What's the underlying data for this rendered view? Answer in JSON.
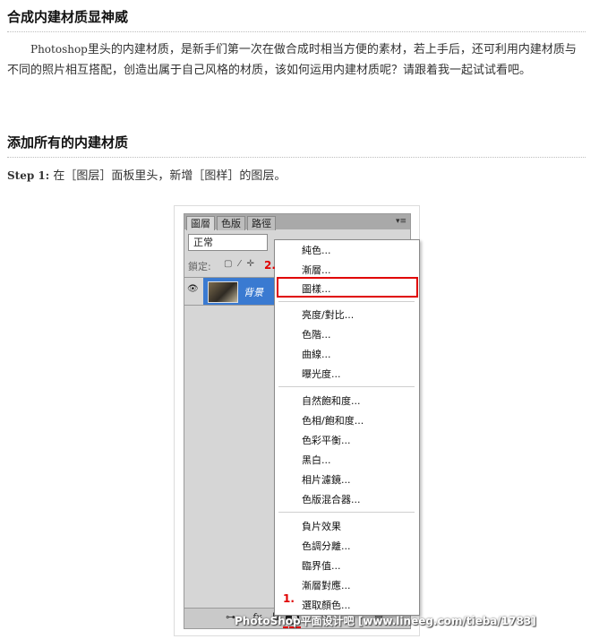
{
  "section1": {
    "title": "合成内建材质显神威",
    "intro_latin": "Photoshop",
    "intro_rest": "里头的内建材质，是新手们第一次在做合成时相当方便的素材，若上手后，还可利用内建材质与不同的照片相互搭配，创造出属于自己风格的材质，该如何运用内建材质呢？请跟着我一起试试看吧。"
  },
  "section2": {
    "title": "添加所有的内建材质",
    "step_label": "Step 1:",
    "step_text": "在［图层］面板里头，新增［图样］的图层。"
  },
  "screenshot": {
    "tabs": [
      "圖層",
      "色版",
      "路徑"
    ],
    "menu_glyph": "▾≡",
    "blend_mode": "正常",
    "lock_label": "鎖定:",
    "layer_name": "背景",
    "bottom_icons": [
      "link-icon",
      "fx-icon",
      "mask-icon",
      "adjustment-icon",
      "folder-icon",
      "new-layer-icon",
      "trash-icon"
    ],
    "bottom_fx": "fx",
    "marker_1": "1.",
    "marker_2": "2.",
    "menu_items": [
      "純色...",
      "漸層...",
      "圖樣...",
      "亮度/對比...",
      "色階...",
      "曲線...",
      "曝光度...",
      "自然飽和度...",
      "色相/飽和度...",
      "色彩平衡...",
      "黑白...",
      "相片濾鏡...",
      "色版混合器...",
      "負片效果",
      "色調分離...",
      "臨界值...",
      "漸層對應...",
      "選取顏色..."
    ],
    "highlighted_item": "圖樣...",
    "highlight_color": "#e00000",
    "selection_color": "#3a7ad1"
  },
  "watermark": "PhotoShop平面设计吧 [www.lineeg.com/tieba/1783]"
}
